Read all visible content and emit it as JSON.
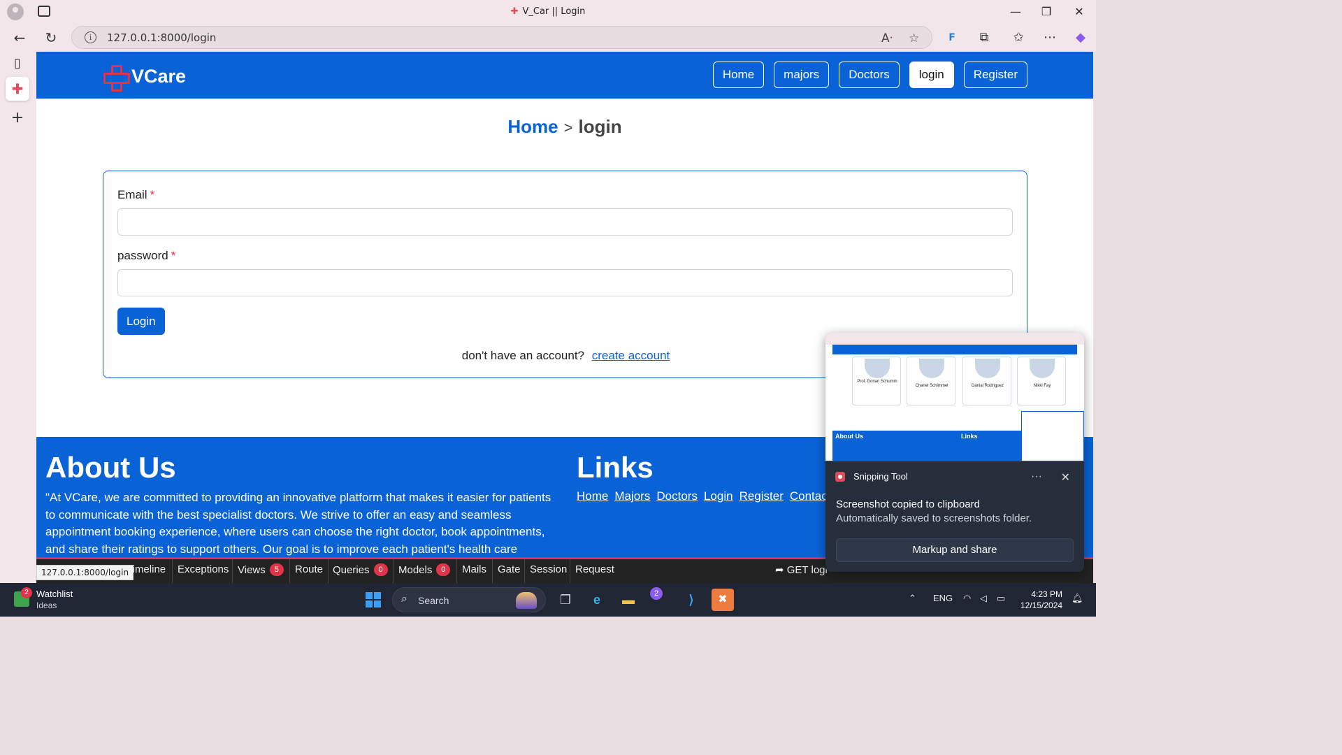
{
  "browser": {
    "window_title": "V_Car || Login",
    "url": "127.0.0.1:8000/login",
    "status_url": "127.0.0.1:8000/login"
  },
  "site": {
    "brand": "VCare",
    "nav": [
      "Home",
      "majors",
      "Doctors",
      "login",
      "Register"
    ],
    "active_nav": "login",
    "breadcrumb": {
      "home": "Home",
      "separator": ">",
      "current": "login"
    },
    "form": {
      "email_label": "Email",
      "email_value": "",
      "password_label": "password",
      "password_value": "",
      "required_mark": "*",
      "submit_label": "Login",
      "signup_prompt": "don't have an account?",
      "signup_link": "create account"
    },
    "footer": {
      "about_title": "About Us",
      "about_text": "\"At VCare, we are committed to providing an innovative platform that makes it easier for patients to communicate with the best specialist doctors. We strive to offer an easy and seamless appointment booking experience, where users can choose the right doctor, book appointments, and share their ratings to support others. Our goal is to improve each patient's health care experience. \"",
      "links_title": "Links",
      "links": [
        "Home",
        "Majors",
        "Doctors",
        "Login",
        "Register",
        "Contact"
      ]
    }
  },
  "debugbar": {
    "items": [
      {
        "label": "Timeline",
        "badge": null
      },
      {
        "label": "Exceptions",
        "badge": null
      },
      {
        "label": "Views",
        "badge": "5"
      },
      {
        "label": "Route",
        "badge": null
      },
      {
        "label": "Queries",
        "badge": "0"
      },
      {
        "label": "Models",
        "badge": "0"
      },
      {
        "label": "Mails",
        "badge": null
      },
      {
        "label": "Gate",
        "badge": null
      },
      {
        "label": "Session",
        "badge": null
      },
      {
        "label": "Request",
        "badge": null
      }
    ],
    "request": "GET logi"
  },
  "toast": {
    "app": "Snipping Tool",
    "title": "Screenshot copied to clipboard",
    "subtitle": "Automatically saved to screenshots folder.",
    "button": "Markup and share",
    "thumb_footer_about": "About Us",
    "thumb_footer_links": "Links",
    "thumb_doctors": [
      "Prof. Dorian Schumm",
      "Chanel Schimmel",
      "Danial Rodriguez",
      "Nikki Fay"
    ]
  },
  "taskbar": {
    "widget_title": "Watchlist",
    "widget_sub": "Ideas",
    "widget_badge": "2",
    "search_label": "Search",
    "app_badge": "2",
    "language": "ENG",
    "time": "4:23 PM",
    "date": "12/15/2024"
  },
  "colors": {
    "brand_blue": "#0a63d6",
    "accent_red": "#e0344a",
    "toast_bg": "#262d3b",
    "taskbar_bg": "#202634"
  }
}
